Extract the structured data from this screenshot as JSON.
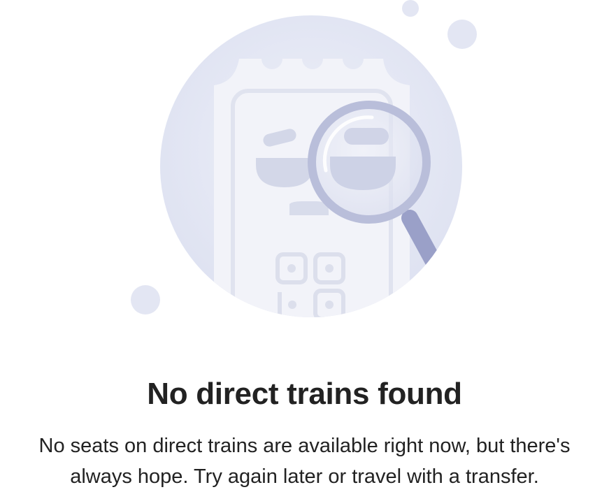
{
  "empty_state": {
    "title": "No direct trains found",
    "message": "No seats on direct trains are available right now, but there's always hope. Try again later or travel with a transfer.",
    "illustration_icon": "ticket-search-magnifier-icon"
  },
  "colors": {
    "circle_bg": "#E3E6F3",
    "ticket": "#F2F3F9",
    "ticket_detail": "#D8DCEB",
    "magnifier_ring": "#B9BEDA",
    "magnifier_handle": "#9AA0C8",
    "text": "#222222"
  }
}
